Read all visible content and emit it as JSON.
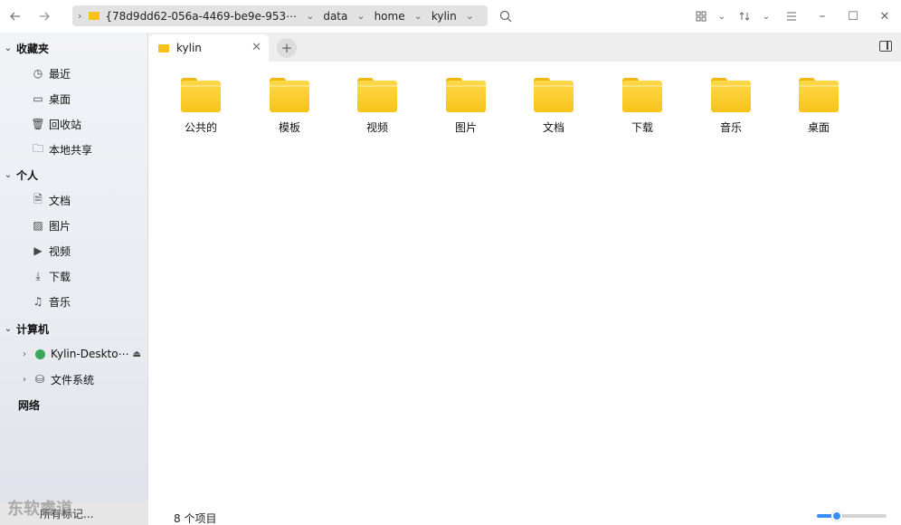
{
  "toolbar": {
    "back_icon": "arrow-left-icon",
    "forward_icon": "arrow-right-icon",
    "path_segments": [
      "{78d9dd62-056a-4469-be9e-953⋯",
      "data",
      "home",
      "kylin"
    ],
    "search_icon": "search-icon",
    "view_icon": "grid-view-icon",
    "sort_icon": "sort-icon",
    "menu_icon": "menu-icon",
    "minimize": "–",
    "maximize": "☐",
    "close": "✕"
  },
  "sidebar": {
    "sections": [
      {
        "label": "收藏夹",
        "items": [
          "最近",
          "桌面",
          "回收站",
          "本地共享"
        ]
      },
      {
        "label": "个人",
        "items": [
          "文档",
          "图片",
          "视频",
          "下载",
          "音乐"
        ]
      },
      {
        "label": "计算机",
        "items": [
          "Kylin-Deskto⋯",
          "文件系统"
        ]
      },
      {
        "label": "网络",
        "items": []
      }
    ],
    "bottom_label": "所有标记..."
  },
  "tabs": [
    {
      "label": "kylin"
    }
  ],
  "files": [
    {
      "name": "公共的"
    },
    {
      "name": "模板"
    },
    {
      "name": "视频"
    },
    {
      "name": "图片"
    },
    {
      "name": "文档"
    },
    {
      "name": "下载"
    },
    {
      "name": "音乐"
    },
    {
      "name": "桌面"
    }
  ],
  "status": {
    "count_text": "8 个项目"
  },
  "zoom": {
    "level": 0.28
  },
  "watermark": "东软睿道",
  "colors": {
    "folder": "#f7c31b",
    "accent": "#3790fa"
  }
}
